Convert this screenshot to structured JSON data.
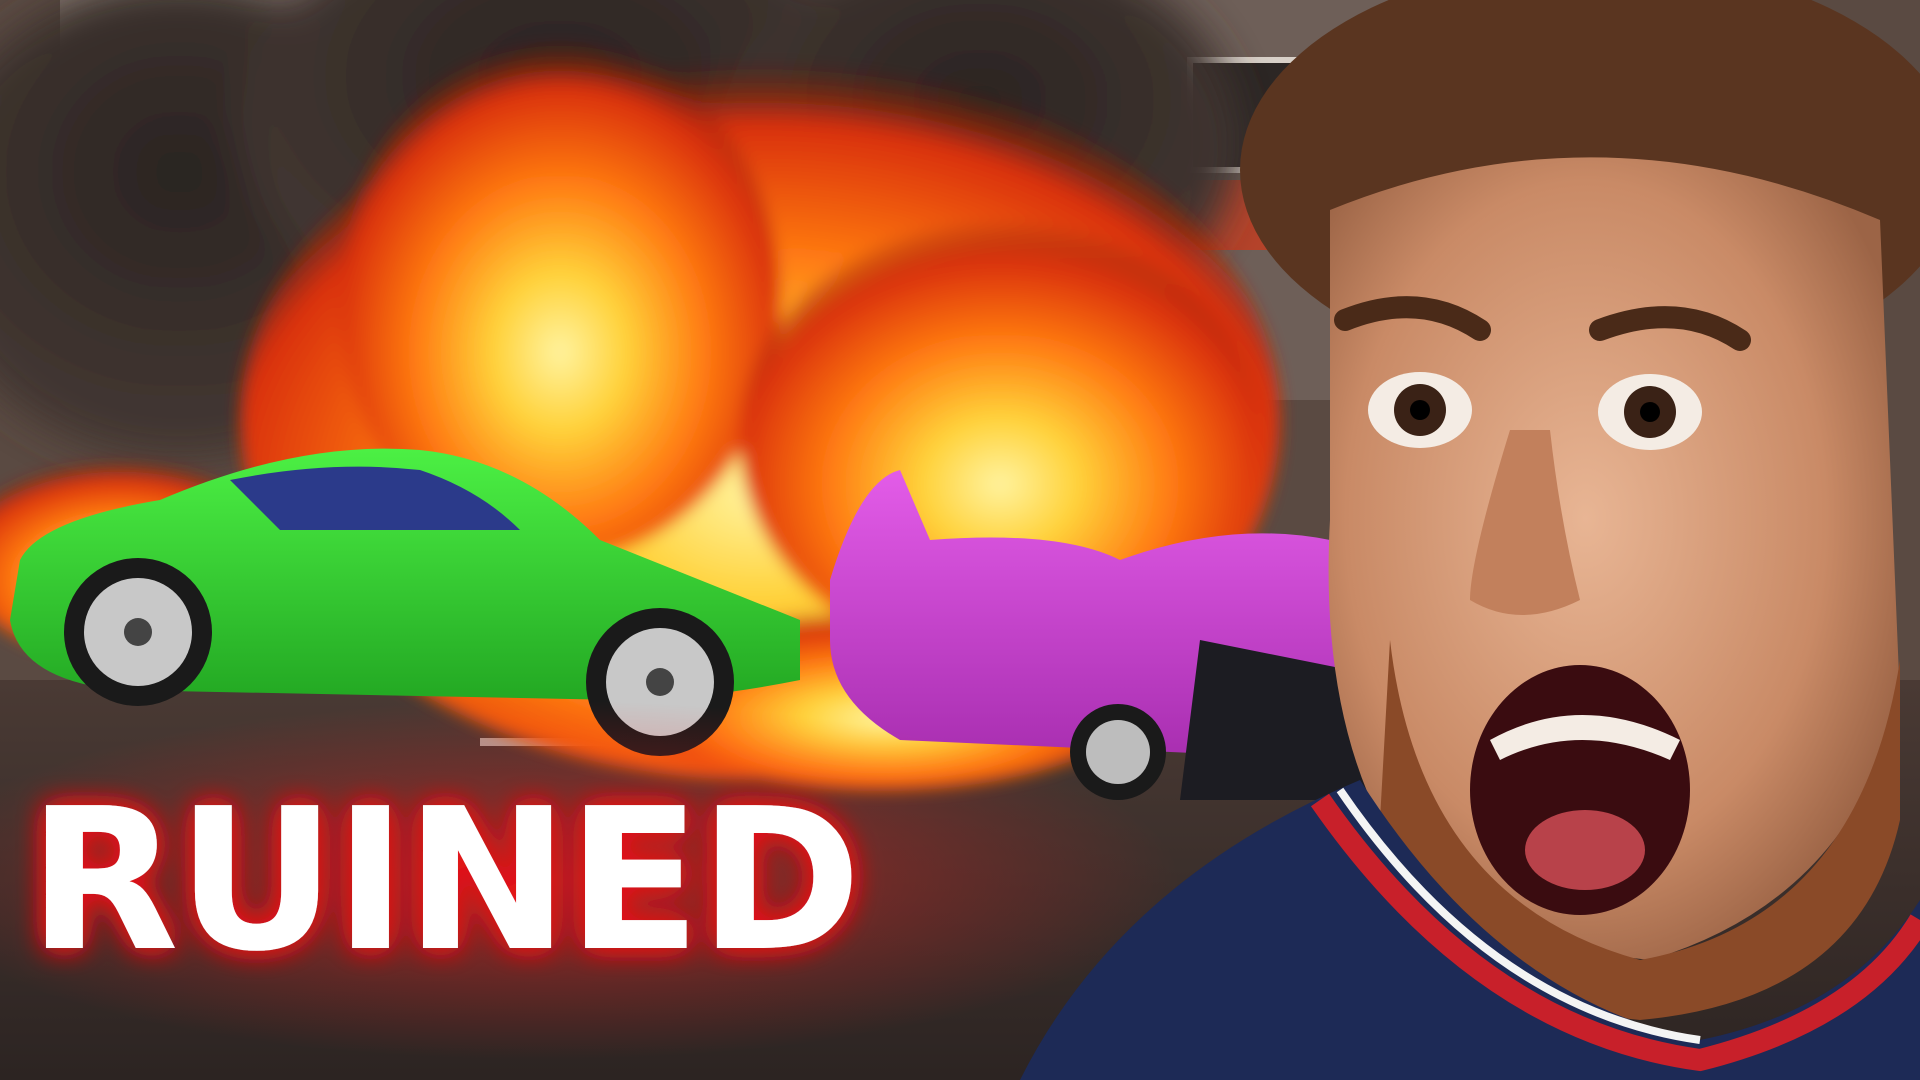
{
  "headline": "RUINED",
  "colors": {
    "headline_text": "#ffffff",
    "headline_glow": "#e4161c",
    "fire_core": "#ffd23a",
    "fire_mid": "#ff7a12",
    "fire_edge": "#d9300b",
    "smoke": "#2a2422",
    "green_car": "#35d631",
    "pink_car": "#d13fd8",
    "jersey_navy": "#1d2a56",
    "jersey_red": "#c8202a"
  }
}
